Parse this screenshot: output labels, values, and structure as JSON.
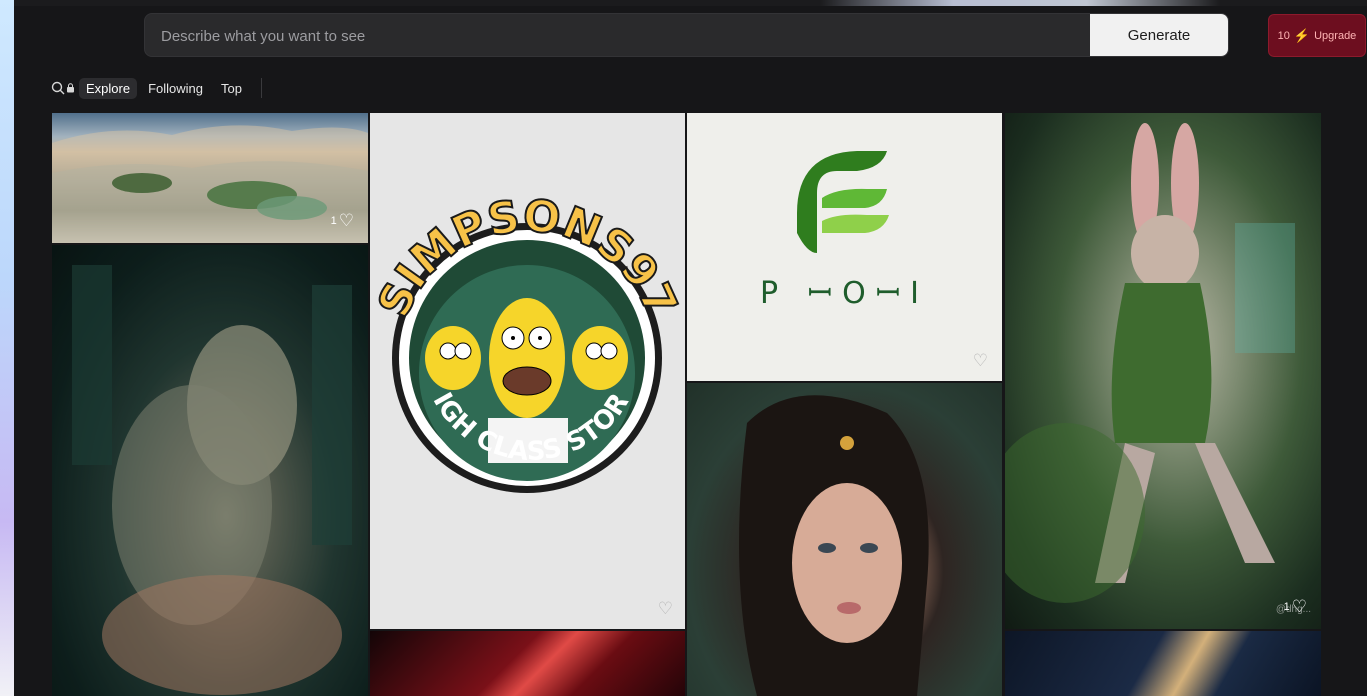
{
  "search": {
    "placeholder": "Describe what you want to see",
    "generate_label": "Generate"
  },
  "upgrade": {
    "credits": "10",
    "label": "Upgrade",
    "bolt_icon": "lightning-bolt-icon"
  },
  "nav": {
    "tabs": [
      "Explore",
      "Following",
      "Top"
    ],
    "active": "Explore"
  },
  "gallery": [
    {
      "id": "desert-dunes",
      "likes": "1"
    },
    {
      "id": "dark-figures",
      "likes": ""
    },
    {
      "id": "simpsons-logo",
      "likes": "",
      "logo": {
        "top_text": "SIMPSONS97",
        "bottom_text": "HIGH CLASS STORE"
      }
    },
    {
      "id": "red-abstract",
      "likes": ""
    },
    {
      "id": "green-f-logo",
      "likes": "",
      "logo_text": "P ꟷOꟷI"
    },
    {
      "id": "portrait-woman",
      "likes": ""
    },
    {
      "id": "rabbit-creature",
      "likes": "1",
      "watermark": "@dhg..."
    },
    {
      "id": "navy-gold",
      "likes": ""
    }
  ],
  "colors": {
    "background": "#161618",
    "upgrade_bg": "#6d0e1f",
    "generate_bg": "#f1f1f1"
  }
}
